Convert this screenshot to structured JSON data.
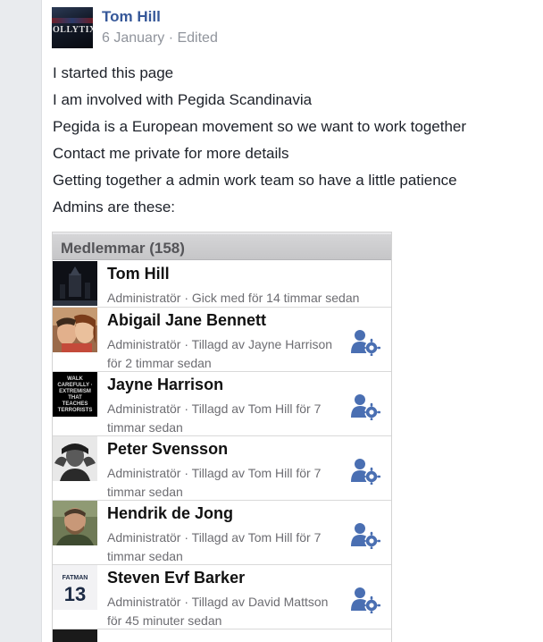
{
  "post": {
    "author": "Tom Hill",
    "date": "6 January",
    "separator": " · ",
    "edited_label": "Edited",
    "avatar_text": "OLLYTIX",
    "lines": [
      "I started this page",
      "I am involved with Pegida Scandinavia",
      "Pegida is a European movement so we want to work together",
      "Contact me private for more details",
      "Getting together a admin work team so have a little patience",
      "Admins are these:"
    ]
  },
  "screenshot": {
    "header": "Medlemmar (158)",
    "members": [
      {
        "name": "Tom Hill",
        "detail": "Administratör · Gick med för 14 timmar sedan",
        "photo": "dark-poster",
        "admin_icon": false
      },
      {
        "name": "Abigail Jane Bennett",
        "detail": "Administratör · Tillagd av Jayne Harrison för 2 timmar sedan",
        "photo": "selfie-couple",
        "admin_icon": true
      },
      {
        "name": "Jayne Harrison",
        "detail": "Administratör · Tillagd av Tom Hill för 7 timmar sedan",
        "photo": "black-text-poster",
        "photo_text": "WALK CAREFULLY · EXTREMISM THAT TEACHES TERRORISTS",
        "admin_icon": true
      },
      {
        "name": "Peter Svensson",
        "detail": "Administratör · Tillagd av Tom Hill för 7 timmar sedan",
        "photo": "man-portrait-bw",
        "admin_icon": true
      },
      {
        "name": "Hendrik de Jong",
        "detail": "Administratör · Tillagd av Tom Hill för 7 timmar sedan",
        "photo": "man-portrait-outdoor",
        "admin_icon": true
      },
      {
        "name": "Steven Evf Barker",
        "detail": "Administratör · Tillagd av David Mattson för 45 minuter sedan",
        "photo": "fatman-jersey",
        "photo_text": "FATMAN",
        "jersey_number": "13",
        "admin_icon": true
      }
    ]
  },
  "colors": {
    "link": "#365899",
    "meta": "#90949c",
    "text": "#1d2129",
    "admin_icon": "#4a6fb2"
  }
}
